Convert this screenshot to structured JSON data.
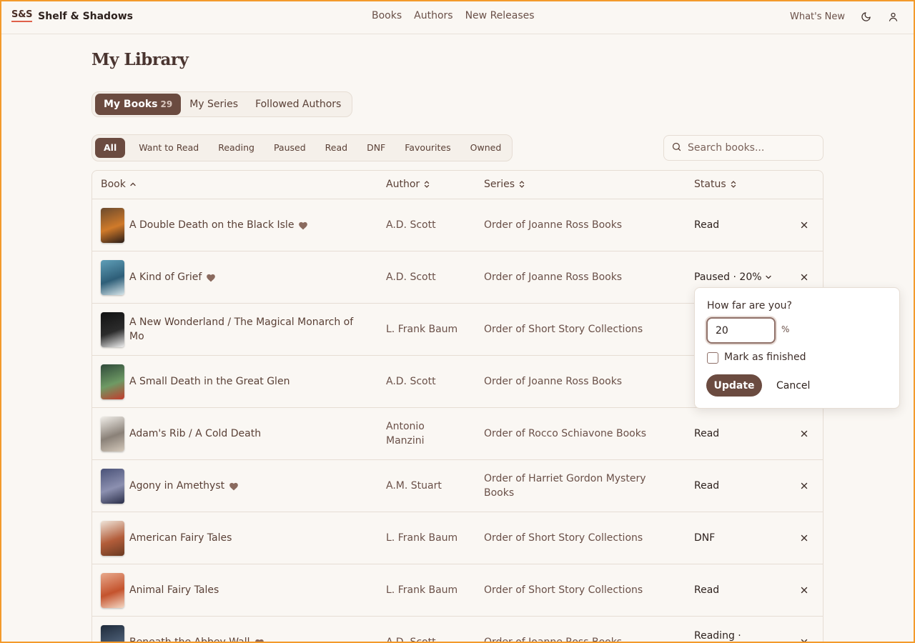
{
  "brand": {
    "mark": "S&S",
    "name": "Shelf & Shadows"
  },
  "nav": [
    "Books",
    "Authors",
    "New Releases"
  ],
  "header_right": {
    "whats_new": "What's New",
    "theme_icon": "moon-icon",
    "account_icon": "user-icon"
  },
  "page_title": "My Library",
  "main_tabs": [
    {
      "label": "My Books",
      "count": "29",
      "active": true
    },
    {
      "label": "My Series",
      "count": "",
      "active": false
    },
    {
      "label": "Followed Authors",
      "count": "",
      "active": false
    }
  ],
  "filters": [
    "All",
    "Want to Read",
    "Reading",
    "Paused",
    "Read",
    "DNF",
    "Favourites",
    "Owned"
  ],
  "active_filter": "All",
  "search": {
    "placeholder": "Search books...",
    "value": ""
  },
  "table": {
    "columns": [
      "Book",
      "Author",
      "Series",
      "Status"
    ],
    "rows": [
      {
        "title": "A Double Death on the Black Isle",
        "favourite": true,
        "author": "A.D. Scott",
        "series": "Order of Joanne Ross Books",
        "status": "Read",
        "cover": [
          "#6b4a2e",
          "#d07a2a",
          "#2a1d18"
        ]
      },
      {
        "title": "A Kind of Grief",
        "favourite": true,
        "author": "A.D. Scott",
        "series": "Order of Joanne Ross Books",
        "status": "Paused · 20%",
        "cover": [
          "#5f9fb8",
          "#2e5e78",
          "#d8e6ea"
        ]
      },
      {
        "title": "A New Wonderland / The Magical Monarch of Mo",
        "favourite": false,
        "author": "L. Frank Baum",
        "series": "Order of Short Story Collections",
        "status": "",
        "cover": [
          "#111111",
          "#2c2c2c",
          "#f0f0f0"
        ]
      },
      {
        "title": "A Small Death in the Great Glen",
        "favourite": false,
        "author": "A.D. Scott",
        "series": "Order of Joanne Ross Books",
        "status": "",
        "cover": [
          "#2f4a3a",
          "#6e9a64",
          "#c43b2c"
        ]
      },
      {
        "title": "Adam's Rib / A Cold Death",
        "favourite": false,
        "author": "Antonio Manzini",
        "series": "Order of Rocco Schiavone Books",
        "status": "Read",
        "cover": [
          "#f1eee9",
          "#8a8178",
          "#d4c9bb"
        ]
      },
      {
        "title": "Agony in Amethyst",
        "favourite": true,
        "author": "A.M. Stuart",
        "series": "Order of Harriet Gordon Mystery Books",
        "status": "Read",
        "cover": [
          "#4a5278",
          "#8c90b0",
          "#2a2e48"
        ]
      },
      {
        "title": "American Fairy Tales",
        "favourite": false,
        "author": "L. Frank Baum",
        "series": "Order of Short Story Collections",
        "status": "DNF",
        "cover": [
          "#efe4d8",
          "#b35d3a",
          "#6a3a22"
        ]
      },
      {
        "title": "Animal Fairy Tales",
        "favourite": false,
        "author": "L. Frank Baum",
        "series": "Order of Short Story Collections",
        "status": "Read",
        "cover": [
          "#e8a98c",
          "#c4532d",
          "#f4d8c4"
        ]
      },
      {
        "title": "Beneath the Abbey Wall",
        "favourite": true,
        "author": "A.D. Scott",
        "series": "Order of Joanne Ross Books",
        "status": "Reading ·",
        "cover": [
          "#1e2a3a",
          "#4b5d74",
          "#c8ccd4"
        ]
      }
    ]
  },
  "progress_popover": {
    "label": "How far are you?",
    "value": "20",
    "unit": "%",
    "checkbox_label": "Mark as finished",
    "update_label": "Update",
    "cancel_label": "Cancel"
  }
}
